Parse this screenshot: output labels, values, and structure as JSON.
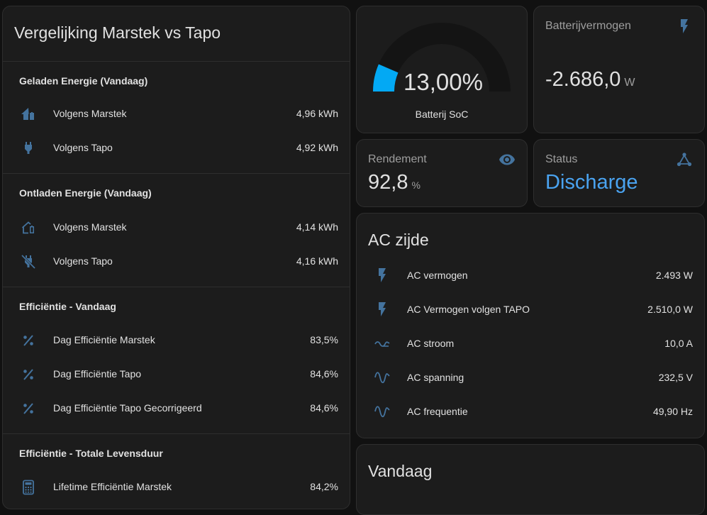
{
  "left_card": {
    "title": "Vergelijking Marstek vs Tapo",
    "sections": [
      {
        "title": "Geladen Energie (Vandaag)",
        "rows": [
          {
            "icon": "home-battery-icon",
            "label": "Volgens Marstek",
            "value": "4,96 kWh"
          },
          {
            "icon": "power-plug-icon",
            "label": "Volgens Tapo",
            "value": "4,92 kWh"
          }
        ]
      },
      {
        "title": "Ontladen Energie (Vandaag)",
        "rows": [
          {
            "icon": "home-battery-outline-icon",
            "label": "Volgens Marstek",
            "value": "4,14 kWh"
          },
          {
            "icon": "power-plug-off-icon",
            "label": "Volgens Tapo",
            "value": "4,16 kWh"
          }
        ]
      },
      {
        "title": "Efficiëntie - Vandaag",
        "rows": [
          {
            "icon": "percent-icon",
            "label": "Dag Efficiëntie Marstek",
            "value": "83,5%"
          },
          {
            "icon": "percent-icon",
            "label": "Dag Efficiëntie Tapo",
            "value": "84,6%"
          },
          {
            "icon": "percent-icon",
            "label": "Dag Efficiëntie Tapo Gecorrigeerd",
            "value": "84,6%"
          }
        ]
      },
      {
        "title": "Efficiëntie - Totale Levensduur",
        "rows": [
          {
            "icon": "calculator-icon",
            "label": "Lifetime Efficiëntie Marstek",
            "value": "84,2%"
          }
        ]
      }
    ]
  },
  "gauge": {
    "value": "13,00%",
    "fraction": 0.13,
    "name": "Batterij SoC"
  },
  "battery_power": {
    "name": "Batterijvermogen",
    "value": "-2.686,0",
    "unit": "W",
    "icon": "flash-icon"
  },
  "efficiency": {
    "name": "Rendement",
    "value": "92,8",
    "unit": "%",
    "icon": "eye-icon"
  },
  "status": {
    "name": "Status",
    "value": "Discharge",
    "icon": "triangle-network-icon"
  },
  "ac_card": {
    "title": "AC zijde",
    "rows": [
      {
        "icon": "flash-icon",
        "label": "AC vermogen",
        "value": "2.493 W"
      },
      {
        "icon": "flash-icon",
        "label": "AC Vermogen volgen TAPO",
        "value": "2.510,0 W"
      },
      {
        "icon": "current-ac-icon",
        "label": "AC stroom",
        "value": "10,0 A"
      },
      {
        "icon": "sine-wave-icon",
        "label": "AC spanning",
        "value": "232,5 V"
      },
      {
        "icon": "sine-wave-icon",
        "label": "AC frequentie",
        "value": "49,90 Hz"
      }
    ]
  },
  "vandaag_card": {
    "title": "Vandaag"
  },
  "colors": {
    "accent": "#03a9f4",
    "icon": "#44739e",
    "status": "#4aa3f0",
    "card": "#1c1c1c"
  }
}
